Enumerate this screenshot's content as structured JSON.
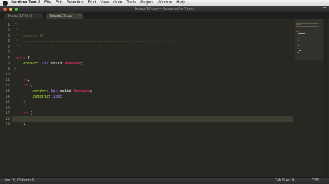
{
  "menubar": {
    "app": "Sublime Text 2",
    "items": [
      "File",
      "Edit",
      "Selection",
      "Find",
      "View",
      "Goto",
      "Tools",
      "Project",
      "Window",
      "Help"
    ]
  },
  "window": {
    "title": "lesson17.css — Lessons for Video"
  },
  "tabs": [
    {
      "label": "lesson17.html",
      "active": false
    },
    {
      "label": "lesson17.css",
      "active": true
    }
  ],
  "tab_close_glyph": "×",
  "editor": {
    "current_line": 18,
    "lines": [
      {
        "n": 1,
        "tokens": [
          [
            "comment",
            "/*"
          ]
        ]
      },
      {
        "n": 2,
        "tokens": [
          [
            "comment",
            " * ---------------------------------------------------------------------"
          ]
        ]
      },
      {
        "n": 3,
        "tokens": [
          [
            "comment",
            " *  Lesson 17"
          ]
        ]
      },
      {
        "n": 4,
        "tokens": [
          [
            "comment",
            " * ---------------------------------------------------------------------"
          ]
        ]
      },
      {
        "n": 5,
        "tokens": [
          [
            "comment",
            " */"
          ]
        ]
      },
      {
        "n": 6,
        "tokens": []
      },
      {
        "n": 7,
        "tokens": [
          [
            "selector",
            "table"
          ],
          [
            "plain",
            " {"
          ]
        ]
      },
      {
        "n": 8,
        "tokens": [
          [
            "plain",
            "    "
          ],
          [
            "property",
            "border"
          ],
          [
            "plain",
            ": "
          ],
          [
            "number",
            "2px"
          ],
          [
            "plain",
            " solid "
          ],
          [
            "selector",
            "#eeeeee"
          ],
          [
            "plain",
            ";"
          ]
        ]
      },
      {
        "n": 9,
        "tokens": [
          [
            "plain",
            "}"
          ]
        ]
      },
      {
        "n": 10,
        "tokens": []
      },
      {
        "n": 11,
        "tokens": [
          [
            "plain",
            "    "
          ],
          [
            "selector",
            "th"
          ],
          [
            "plain",
            ","
          ]
        ]
      },
      {
        "n": 12,
        "tokens": [
          [
            "plain",
            "    "
          ],
          [
            "selector",
            "td"
          ],
          [
            "plain",
            " {"
          ]
        ]
      },
      {
        "n": 13,
        "tokens": [
          [
            "plain",
            "        "
          ],
          [
            "property",
            "border"
          ],
          [
            "plain",
            ": "
          ],
          [
            "number",
            "1px"
          ],
          [
            "plain",
            " solid "
          ],
          [
            "selector",
            "#eeeeee"
          ],
          [
            "plain",
            ";"
          ]
        ]
      },
      {
        "n": 14,
        "tokens": [
          [
            "plain",
            "        "
          ],
          [
            "property",
            "padding"
          ],
          [
            "plain",
            ": "
          ],
          [
            "number",
            "1em"
          ],
          [
            "plain",
            ";"
          ]
        ]
      },
      {
        "n": 15,
        "tokens": [
          [
            "plain",
            "    }"
          ]
        ]
      },
      {
        "n": 16,
        "tokens": []
      },
      {
        "n": 17,
        "tokens": [
          [
            "plain",
            "    "
          ],
          [
            "selector",
            "th"
          ],
          [
            "plain",
            " {"
          ]
        ]
      },
      {
        "n": 18,
        "tokens": [
          [
            "plain",
            "        "
          ]
        ],
        "caret": true
      },
      {
        "n": 19,
        "tokens": [
          [
            "plain",
            "    }"
          ]
        ]
      }
    ]
  },
  "status": {
    "position": "Line 18, Column 9",
    "tab_size": "Tab Size: 4",
    "syntax": "CSS"
  },
  "colors": {
    "background": "#272822",
    "comment": "#75715e",
    "keyword": "#f92672",
    "property": "#a6e22e",
    "number": "#ae81ff",
    "text": "#f8f8f2"
  }
}
